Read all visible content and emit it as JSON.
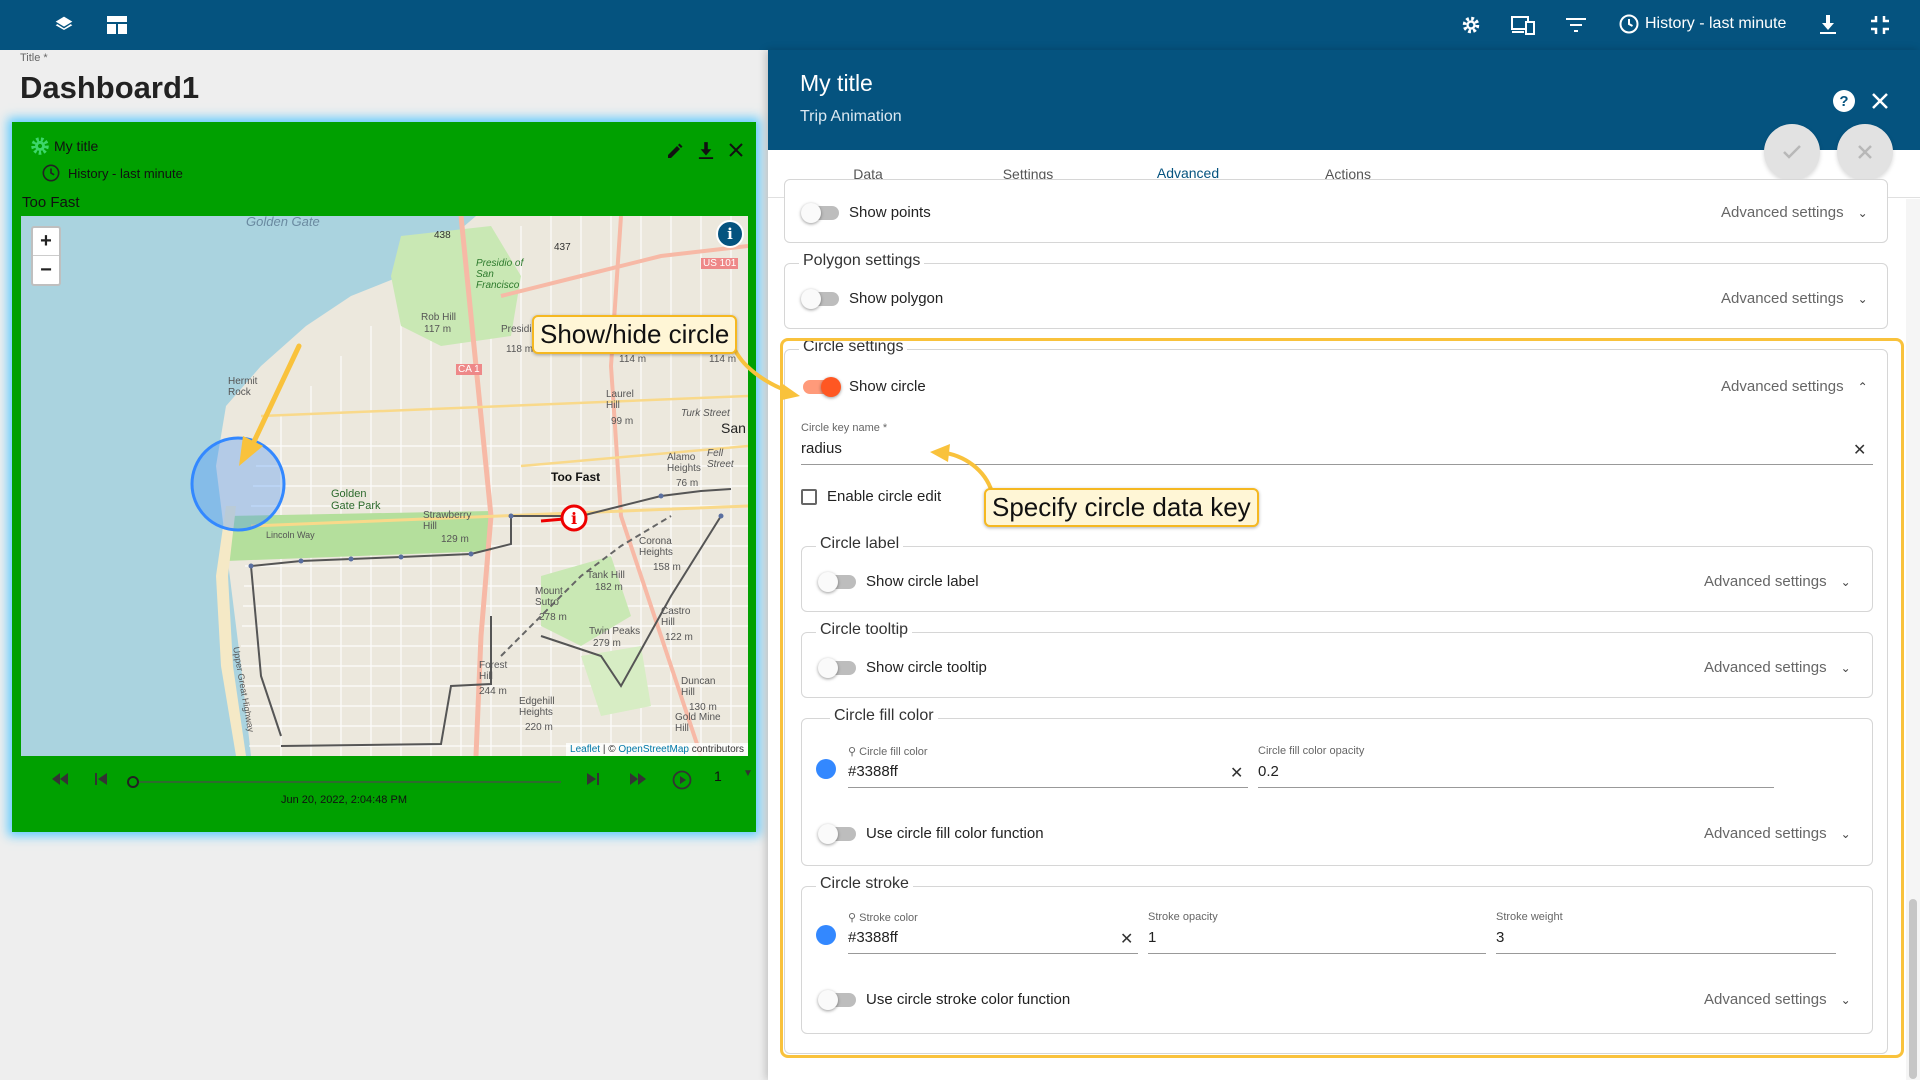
{
  "topbar": {
    "history_label": "History - last minute",
    "icons": [
      "layers-icon",
      "dashboard-icon",
      "settings-icon",
      "devices-icon",
      "filter-icon",
      "clock-icon",
      "download-icon",
      "fullscreen-exit-icon"
    ]
  },
  "dashboard": {
    "title_label": "Title *",
    "title": "Dashboard1"
  },
  "widget": {
    "title": "My title",
    "history": "History - last minute",
    "subtitle": "Too Fast",
    "attribution": {
      "leaflet": "Leaflet",
      "sep": " | © ",
      "osm": "OpenStreetMap",
      "suffix": " contributors"
    },
    "map_labels": {
      "golden_gate": "Golden Gate",
      "presidio": "Presidio of San Francisco",
      "rob_hill": "Rob Hill",
      "rob_hill_elev": "117 m",
      "presidio_hill": "Presidio Hill",
      "presidio_hill_elev": "118 m",
      "hermit_rock": "Hermit Rock",
      "golden_gate_park": "Golden Gate Park",
      "strawberry_hill": "Strawberry Hill",
      "strawberry_elev": "129 m",
      "laurel_hill": "Laurel Hill",
      "laurel_elev": "99 m",
      "alamo_heights": "Alamo Heights",
      "alamo_elev": "76 m",
      "too_fast": "Too Fast",
      "corona_heights": "Corona Heights",
      "corona_elev": "158 m",
      "tank_hill": "Tank Hill",
      "tank_elev": "182 m",
      "mount_sutro": "Mount Sutro",
      "sutro_elev": "278 m",
      "twin_peaks": "Twin Peaks",
      "twin_elev": "279 m",
      "castro_hill": "Castro Hill",
      "castro_elev": "122 m",
      "forest_hill": "Forest Hill",
      "forest_elev": "244 m",
      "edgehill": "Edgehill Heights",
      "edgehill_elev": "220 m",
      "duncan_hill": "Duncan Hill",
      "duncan_elev": "130 m",
      "gold_mine": "Gold Mine Hill",
      "lincoln_way": "Lincoln Way",
      "upper_great_hwy": "Upper Great Highway",
      "turk_street": "Turk Street",
      "fell_street": "Fell Street",
      "san": "San",
      "ca1": "CA 1",
      "us101": "US 101",
      "r438": "438",
      "r437": "437",
      "elev114": "114 m",
      "elev114b": "114 m"
    },
    "player": {
      "timestamp": "Jun 20, 2022, 2:04:48 PM",
      "speed": "1",
      "progress": 0
    }
  },
  "callouts": {
    "show_hide": "Show/hide circle",
    "specify_key": "Specify circle data key"
  },
  "panel": {
    "title": "My title",
    "subtitle": "Trip Animation",
    "tabs": [
      {
        "label": "Data",
        "active": false
      },
      {
        "label": "Settings",
        "active": false
      },
      {
        "label": "Advanced",
        "active": true
      },
      {
        "label": "Actions",
        "active": false
      }
    ],
    "advanced_settings": "Advanced settings",
    "points": {
      "toggle_label": "Show points",
      "on": false
    },
    "polygon": {
      "legend": "Polygon settings",
      "toggle_label": "Show polygon",
      "on": false
    },
    "circle": {
      "legend": "Circle settings",
      "toggle_label": "Show circle",
      "on": true,
      "key_label": "Circle key name *",
      "key_value": "radius",
      "edit_label": "Enable circle edit",
      "edit_checked": false,
      "label_group": {
        "legend": "Circle label",
        "toggle_label": "Show circle label",
        "on": false
      },
      "tooltip_group": {
        "legend": "Circle tooltip",
        "toggle_label": "Show circle tooltip",
        "on": false
      },
      "fill": {
        "legend": "Circle fill color",
        "color_label": "Circle fill color",
        "color_value": "#3388ff",
        "opacity_label": "Circle fill color opacity",
        "opacity_value": "0.2",
        "function_label": "Use circle fill color function",
        "function_on": false
      },
      "stroke": {
        "legend": "Circle stroke",
        "color_label": "Stroke color",
        "color_value": "#3388ff",
        "opacity_label": "Stroke opacity",
        "opacity_value": "1",
        "weight_label": "Stroke weight",
        "weight_value": "3",
        "function_label": "Use circle stroke color function",
        "function_on": false
      }
    }
  },
  "colors": {
    "brand": "#05537f",
    "widget_bg": "#00a000",
    "toggle_on": "#ff5722",
    "highlight": "#f9c23c",
    "circle_color": "#3388ff"
  }
}
